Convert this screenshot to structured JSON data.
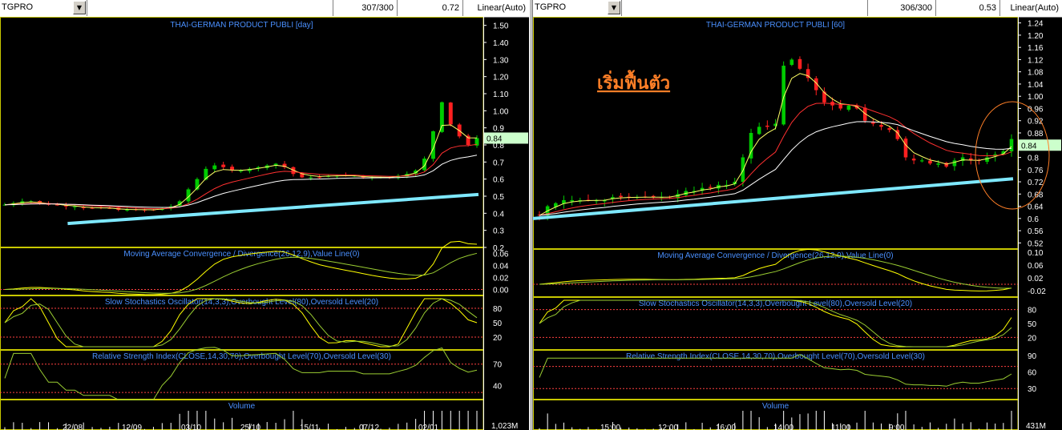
{
  "colors": {
    "bg": "#000000",
    "frame": "#c8c800",
    "title": "#4a90ff",
    "axis": "#ffffff",
    "up": "#00cc00",
    "down": "#ff2020",
    "ma_fast": "#ffff66",
    "ma_mid": "#ff3030",
    "ma_slow": "#ffffff",
    "ma_long": "#7ee8ff",
    "osc1": "#ffff00",
    "osc2": "#9acd32",
    "level": "#ff4040",
    "annotation": "#ff7f27",
    "price_box": "#ccffcc"
  },
  "left": {
    "symbol": "TGPRO",
    "counter": "307/300",
    "value": "0.72",
    "scale": "Linear(Auto)",
    "price_title": "THAI-GERMAN PRODUCT PUBLI [day]",
    "last_price": "0.84",
    "macd_title": "Moving Average Convergence / Divergence(26,12,9),Value Line(0)",
    "stoch_title": "Slow Stochastics Oscillator(14,3,3),Overbought Level(80),Oversold Level(20)",
    "rsi_title": "Relative Strength Index(CLOSE,14,30,70),Overbought Level(70),Oversold Level(30)",
    "vol_title": "Volume",
    "vol_label": "1,023M",
    "x_ticks": [
      "22/08",
      "12/09",
      "03/10",
      "25/10",
      "15/11",
      "07/12",
      "02/01"
    ]
  },
  "right": {
    "symbol": "TGPRO",
    "counter": "306/300",
    "value": "0.53",
    "scale": "Linear(Auto)",
    "price_title": "THAI-GERMAN PRODUCT PUBLI [60]",
    "last_price": "0.84",
    "annotation": "เริ่มฟื้นตัว",
    "macd_title": "Moving Average Convergence / Divergence(26,12,9),Value Line(0)",
    "stoch_title": "Slow Stochastics Oscillator(14,3,3),Overbought Level(80),Oversold Level(20)",
    "rsi_title": "Relative Strength Index(CLOSE,14,30,70),Overbought Level(70),Oversold Level(30)",
    "vol_title": "Volume",
    "vol_label": "431M",
    "x_ticks": [
      "15:00",
      "12:00",
      "16:00",
      "14:00",
      "11:00",
      "9:00"
    ]
  },
  "chart_data": [
    {
      "type": "candlestick",
      "title": "THAI-GERMAN PRODUCT PUBLI [day]",
      "ylim": [
        0.2,
        1.55
      ],
      "y_ticks": [
        1.5,
        1.4,
        1.3,
        1.2,
        1.1,
        1.0,
        0.9,
        0.8,
        0.7,
        0.6,
        0.5,
        0.4,
        0.3,
        0.2
      ],
      "x_ticks": [
        "22/08",
        "12/09",
        "03/10",
        "25/10",
        "15/11",
        "07/12",
        "02/01"
      ],
      "close": [
        0.45,
        0.46,
        0.47,
        0.47,
        0.46,
        0.45,
        0.45,
        0.44,
        0.44,
        0.43,
        0.43,
        0.43,
        0.43,
        0.42,
        0.42,
        0.42,
        0.42,
        0.42,
        0.43,
        0.44,
        0.47,
        0.54,
        0.6,
        0.66,
        0.68,
        0.67,
        0.65,
        0.65,
        0.66,
        0.67,
        0.68,
        0.69,
        0.67,
        0.63,
        0.61,
        0.61,
        0.61,
        0.62,
        0.62,
        0.62,
        0.62,
        0.61,
        0.61,
        0.61,
        0.61,
        0.62,
        0.63,
        0.65,
        0.72,
        0.88,
        1.05,
        0.92,
        0.85,
        0.8,
        0.84
      ],
      "ma_long": {
        "x_range": [
          0.14,
          0.99
        ],
        "y_range": [
          0.34,
          0.51
        ]
      },
      "macd": {
        "ylim": [
          -0.01,
          0.07
        ],
        "y_ticks": [
          0.06,
          0.04,
          0.02,
          0.0
        ]
      },
      "stochastic": {
        "ylim": [
          0,
          100
        ],
        "y_ticks": [
          80,
          50,
          20
        ],
        "levels": [
          80,
          20
        ]
      },
      "rsi": {
        "ylim": [
          20,
          90
        ],
        "y_ticks": [
          70,
          40
        ],
        "levels": [
          70,
          30
        ]
      },
      "volume": {
        "label": "1,023M"
      }
    },
    {
      "type": "candlestick",
      "title": "THAI-GERMAN PRODUCT PUBLI [60]",
      "ylim": [
        0.5,
        1.26
      ],
      "y_ticks": [
        1.24,
        1.2,
        1.16,
        1.12,
        1.08,
        1.04,
        1.0,
        0.96,
        0.92,
        0.88,
        0.84,
        0.8,
        0.76,
        0.72,
        0.68,
        0.64,
        0.6,
        0.56,
        0.52
      ],
      "x_ticks": [
        "15:00",
        "12:00",
        "16:00",
        "14:00",
        "11:00",
        "9:00"
      ],
      "close": [
        0.61,
        0.64,
        0.65,
        0.66,
        0.66,
        0.66,
        0.66,
        0.66,
        0.66,
        0.67,
        0.67,
        0.67,
        0.67,
        0.67,
        0.67,
        0.67,
        0.67,
        0.68,
        0.69,
        0.69,
        0.7,
        0.7,
        0.71,
        0.71,
        0.72,
        0.8,
        0.88,
        0.9,
        0.9,
        0.91,
        1.1,
        1.12,
        1.09,
        1.06,
        1.02,
        0.98,
        0.97,
        0.96,
        0.97,
        0.96,
        0.92,
        0.91,
        0.9,
        0.89,
        0.86,
        0.8,
        0.79,
        0.79,
        0.78,
        0.78,
        0.77,
        0.79,
        0.8,
        0.79,
        0.79,
        0.8,
        0.81,
        0.82,
        0.86
      ],
      "ma_long": {
        "x_range": [
          0.0,
          0.99
        ],
        "y_range": [
          0.6,
          0.73
        ]
      },
      "macd": {
        "ylim": [
          -0.04,
          0.11
        ],
        "y_ticks": [
          0.1,
          0.06,
          0.02,
          -0.02
        ]
      },
      "stochastic": {
        "ylim": [
          0,
          100
        ],
        "y_ticks": [
          80,
          50,
          20
        ],
        "levels": [
          80,
          20
        ]
      },
      "rsi": {
        "ylim": [
          10,
          100
        ],
        "y_ticks": [
          90,
          60,
          30
        ],
        "levels": [
          70,
          30
        ]
      },
      "volume": {
        "label": "431M"
      }
    }
  ]
}
